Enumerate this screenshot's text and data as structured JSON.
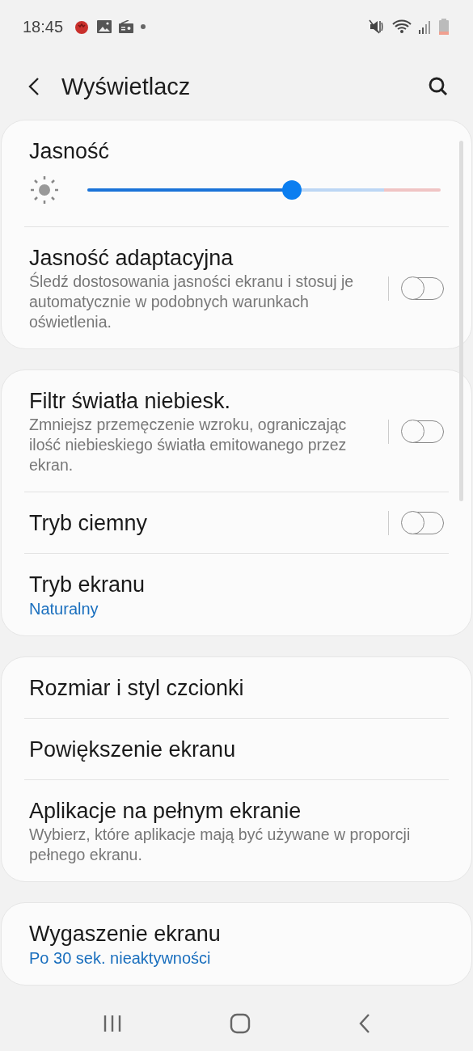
{
  "status_bar": {
    "time": "18:45"
  },
  "header": {
    "title": "Wyświetlacz"
  },
  "cards": [
    {
      "items": [
        {
          "kind": "slider",
          "title": "Jasność",
          "level": 0.58
        },
        {
          "kind": "toggle",
          "title": "Jasność adaptacyjna",
          "description": "Śledź dostosowania jasności ekranu i stosuj je automatycznie w podobnych warunkach oświetlenia.",
          "on": false
        }
      ]
    },
    {
      "items": [
        {
          "kind": "toggle",
          "title": "Filtr światła niebiesk.",
          "description": "Zmniejsz przemęczenie wzroku, ograniczając ilość niebieskiego światła emitowanego przez ekran.",
          "on": false
        },
        {
          "kind": "toggle",
          "title": "Tryb ciemny",
          "on": false
        },
        {
          "kind": "link",
          "title": "Tryb ekranu",
          "value": "Naturalny"
        }
      ]
    },
    {
      "items": [
        {
          "kind": "link",
          "title": "Rozmiar i styl czcionki"
        },
        {
          "kind": "link",
          "title": "Powiększenie ekranu"
        },
        {
          "kind": "link",
          "title": "Aplikacje na pełnym ekranie",
          "description": "Wybierz, które aplikacje mają być używane w proporcji pełnego ekranu."
        }
      ]
    },
    {
      "items": [
        {
          "kind": "link",
          "title": "Wygaszenie ekranu",
          "value": "Po 30 sek. nieaktywności"
        }
      ]
    }
  ]
}
